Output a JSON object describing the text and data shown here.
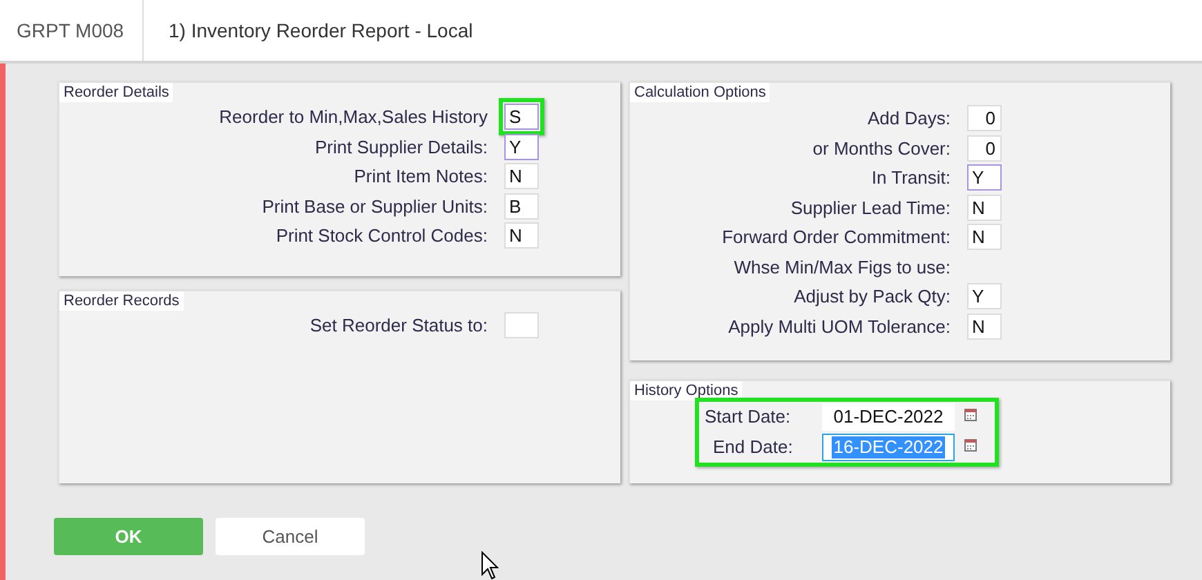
{
  "header": {
    "code": "GRPT M008",
    "title": "1) Inventory Reorder Report - Local"
  },
  "left_panels": [
    {
      "title": "Reorder Details",
      "fields": [
        {
          "label": "Reorder to Min,Max,Sales History",
          "value": "S",
          "kind": "text",
          "active": true,
          "highlighted": true
        },
        {
          "label": "Print Supplier Details:",
          "value": "Y",
          "kind": "text",
          "active": true,
          "highlighted": false
        },
        {
          "label": "Print Item Notes:",
          "value": "N",
          "kind": "text",
          "active": false,
          "highlighted": false
        },
        {
          "label": "Print Base or Supplier Units:",
          "value": "B",
          "kind": "text",
          "active": false,
          "highlighted": false
        },
        {
          "label": "Print Stock Control Codes:",
          "value": "N",
          "kind": "text",
          "active": false,
          "highlighted": false
        }
      ]
    },
    {
      "title": "Reorder Records",
      "fields": [
        {
          "label": "Set Reorder Status to:",
          "kind": "text",
          "active": false,
          "highlighted": false
        }
      ]
    }
  ],
  "calculation_options": {
    "title": "Calculation Options",
    "fields": [
      {
        "label": "Add Days:",
        "value": "0",
        "kind": "number",
        "active": false
      },
      {
        "label": "or Months Cover:",
        "value": "0",
        "kind": "number",
        "active": false
      },
      {
        "label": "In Transit:",
        "value": "Y",
        "kind": "text",
        "active": true
      },
      {
        "label": "Supplier Lead Time:",
        "value": "N",
        "kind": "text",
        "active": false
      },
      {
        "label": "Forward Order Commitment:",
        "value": "N",
        "kind": "text",
        "active": false
      },
      {
        "label": "Whse Min/Max Figs to use:",
        "kind": "label"
      },
      {
        "label": "Adjust by Pack Qty:",
        "value": "Y",
        "kind": "text",
        "active": false
      },
      {
        "label": "Apply Multi UOM Tolerance:",
        "value": "N",
        "kind": "text",
        "active": false
      }
    ]
  },
  "history_options": {
    "title": "History Options",
    "highlighted": true,
    "dates": [
      {
        "label": "Start Date:",
        "value": "01-DEC-2022",
        "selected": false
      },
      {
        "label": "End Date:",
        "value": "16-DEC-2022",
        "selected": true
      }
    ]
  },
  "buttons": [
    {
      "label": "OK",
      "kind": "primary"
    },
    {
      "label": "Cancel",
      "kind": "secondary"
    }
  ]
}
